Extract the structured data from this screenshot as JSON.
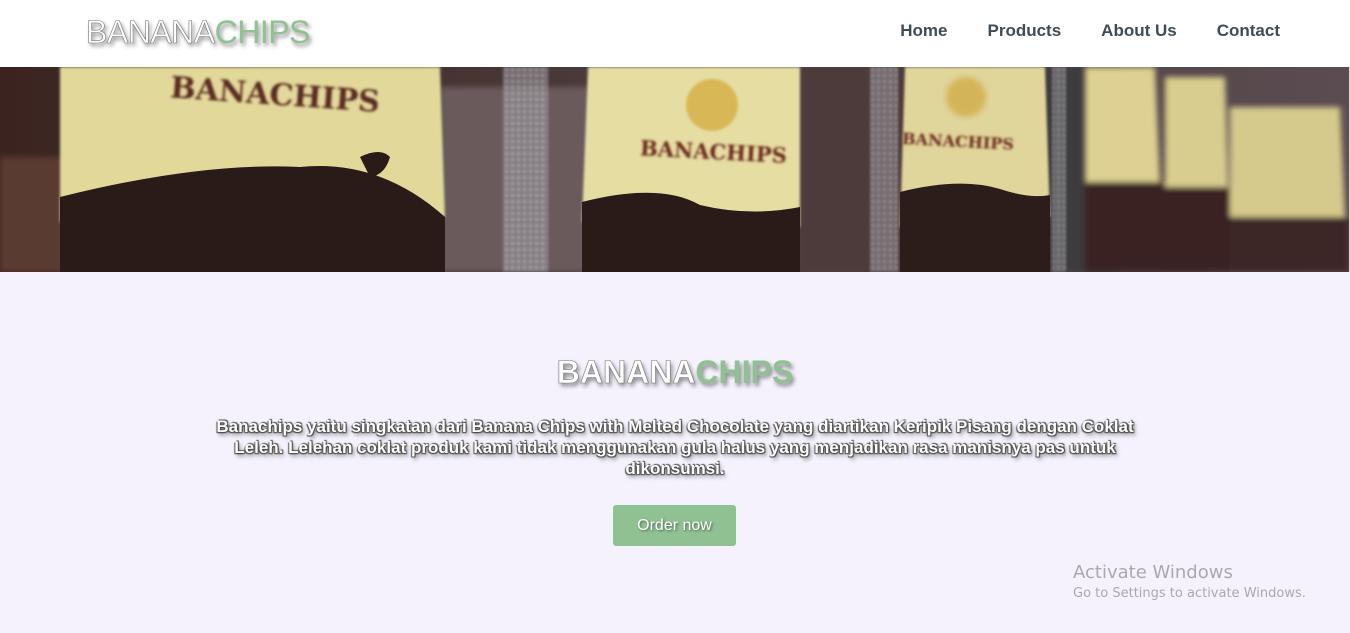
{
  "navbar": {
    "logo_part1": "BANANA",
    "logo_part2": "CHIPS",
    "links": [
      "Home",
      "Products",
      "About Us",
      "Contact"
    ]
  },
  "hero": {
    "bag_print_1": "BANACHIPS",
    "bag_print_2": "BANACHIPS",
    "bag_print_3": "BANACHIPS"
  },
  "main": {
    "title_part1": "BANANA",
    "title_part2": "CHIPS",
    "description": "Banachips yaitu singkatan dari Banana Chips with Melted Chocolate yang diartikan Keripik Pisang dengan Coklat Leleh. Lelehan coklat produk kami tidak menggunakan gula halus yang menjadikan rasa manisnya pas untuk dikonsumsi.",
    "order_button": "Order now"
  },
  "watermark": {
    "title": "Activate Windows",
    "subtitle": "Go to Settings to activate Windows."
  },
  "colors": {
    "accent_green": "#8fc192",
    "nav_text": "#3f4b55",
    "page_background": "#f5f2fd"
  }
}
